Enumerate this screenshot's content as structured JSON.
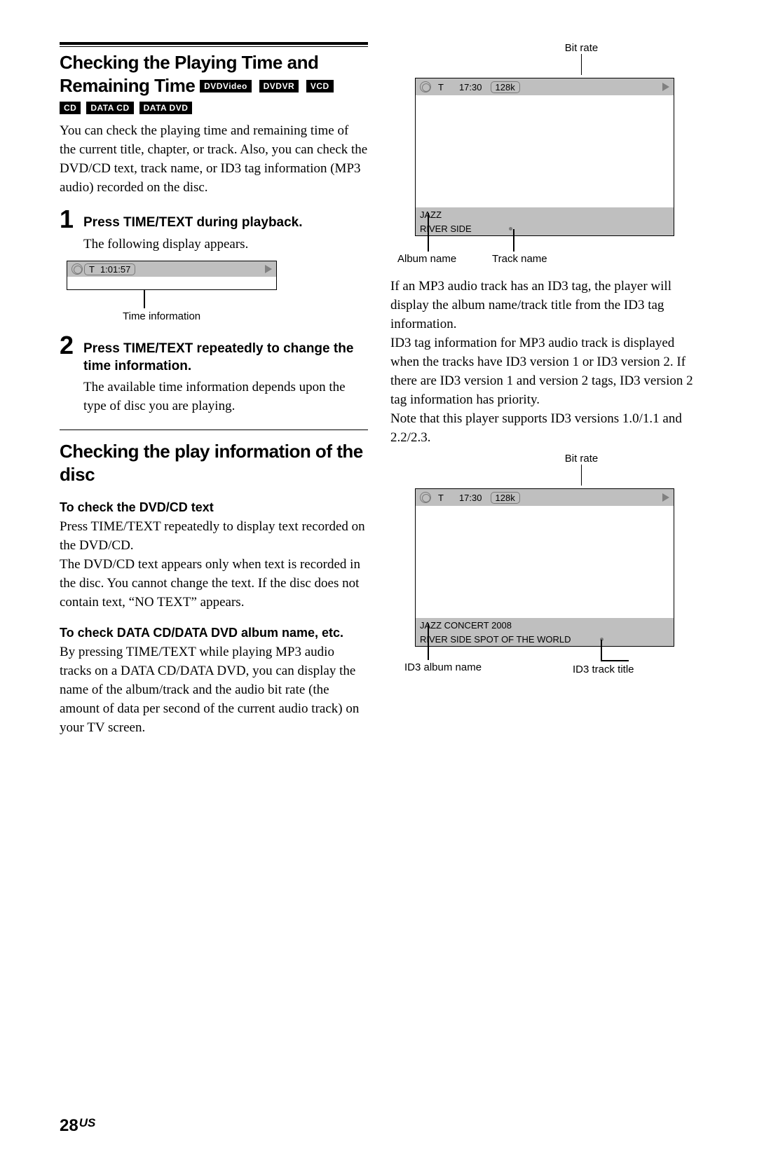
{
  "title": "Checking the Playing Time and Remaining Time",
  "badges_row1": [
    "DVDVideo",
    "DVDVR",
    "VCD"
  ],
  "badges_row2": [
    "CD",
    "DATA CD",
    "DATA DVD"
  ],
  "intro": "You can check the playing time and remaining time of the current title, chapter, or track. Also, you can check the DVD/CD text, track name, or ID3 tag information (MP3 audio) recorded on the disc.",
  "steps": [
    {
      "num": "1",
      "head": "Press TIME/TEXT during playback.",
      "body": "The following display appears."
    },
    {
      "num": "2",
      "head": "Press TIME/TEXT repeatedly to change the time information.",
      "body": "The available time information depends upon the type of disc you are playing."
    }
  ],
  "diag1": {
    "letter": "T",
    "time": "1:01:57",
    "caption": "Time information"
  },
  "section2_title": "Checking the play information of the disc",
  "sub1_head": "To check the DVD/CD text",
  "sub1_body": "Press TIME/TEXT repeatedly to display text recorded on the DVD/CD.\nThe DVD/CD text appears only when text is recorded in the disc. You cannot change the text. If the disc does not contain text, “NO TEXT” appears.",
  "sub2_head": "To check DATA CD/DATA DVD album name, etc.",
  "sub2_body": "By pressing TIME/TEXT while playing MP3 audio tracks on a DATA CD/DATA DVD, you can display the name of the album/track and the audio bit rate (the amount of data per second of the current audio track) on your TV screen.",
  "diag2": {
    "top_label": "Bit rate",
    "letter": "T",
    "time": "17:30",
    "bitrate": "128k",
    "album": "JAZZ",
    "track": "RIVER SIDE",
    "bottom_left": "Album name",
    "bottom_right": "Track name"
  },
  "right_para": "If an MP3 audio track has an ID3 tag, the player will display the album name/track title from the ID3 tag information.\nID3 tag information for MP3 audio track is displayed when the tracks have ID3 version 1 or ID3 version 2. If there are ID3 version 1 and version 2 tags, ID3 version 2 tag information has priority.\nNote that this player supports ID3 versions 1.0/1.1 and 2.2/2.3.",
  "diag3": {
    "top_label": "Bit rate",
    "letter": "T",
    "time": "17:30",
    "bitrate": "128k",
    "album": "JAZZ CONCERT 2008",
    "track": "RIVER SIDE SPOT OF THE WORLD",
    "bottom_left": "ID3 album name",
    "bottom_right": "ID3 track title"
  },
  "page_number": "28",
  "page_suffix": "US"
}
